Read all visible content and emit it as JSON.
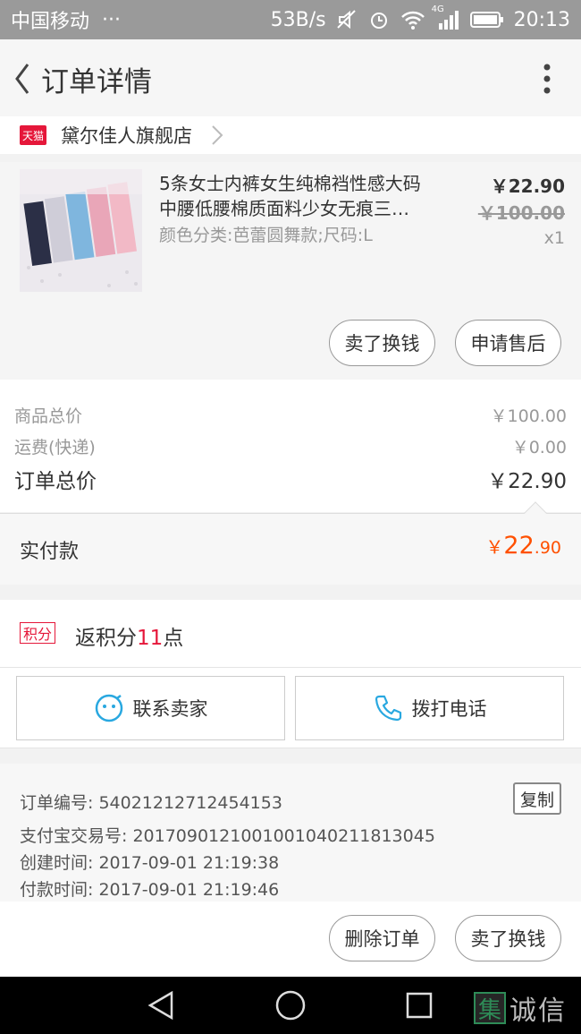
{
  "status_bar": {
    "carrier": "中国移动",
    "dots": "···",
    "speed": "53B/s",
    "network": "4G",
    "time": "20:13"
  },
  "header": {
    "title": "订单详情",
    "back_icon": "back-arrow-icon",
    "more_icon": "more-vertical-icon"
  },
  "shop": {
    "badge": "天猫",
    "name": "黛尔佳人旗舰店"
  },
  "product": {
    "title_line1": "5条女士内裤女生纯棉裆性感大码",
    "title_line2": "中腰低腰棉质面料少女无痕三…",
    "spec": "颜色分类:芭蕾圆舞款;尺码:L",
    "price": "￥22.90",
    "original_price": "￥100.00",
    "quantity": "x1",
    "sell_button": "卖了换钱",
    "aftersale_button": "申请售后"
  },
  "totals": {
    "goods_label": "商品总价",
    "goods_value": "￥100.00",
    "shipping_label": "运费(快递)",
    "shipping_value": "￥0.00",
    "order_label": "订单总价",
    "order_value": "￥22.90"
  },
  "paid": {
    "label": "实付款",
    "currency": "￥",
    "integer": "22",
    "decimal": ".90"
  },
  "points": {
    "tag": "积分",
    "prefix": "返积分",
    "count": "11",
    "suffix": "点"
  },
  "contact": {
    "seller_label": "联系卖家",
    "call_label": "拨打电话"
  },
  "order_info": {
    "order_no": "订单编号:  54021212712454153",
    "alipay_no": "支付宝交易号:  2017090121001001040211813045",
    "created": "创建时间:  2017-09-01 21:19:38",
    "paid": "付款时间:  2017-09-01 21:19:46",
    "copy_button": "复制"
  },
  "actions": {
    "delete_button": "删除订单",
    "sell_button": "卖了换钱"
  },
  "watermark": {
    "glyph": "集",
    "text": "诚信"
  },
  "colors": {
    "accent_red": "#e5173a",
    "price_orange": "#ff5000",
    "contact_blue": "#29a8e0"
  }
}
